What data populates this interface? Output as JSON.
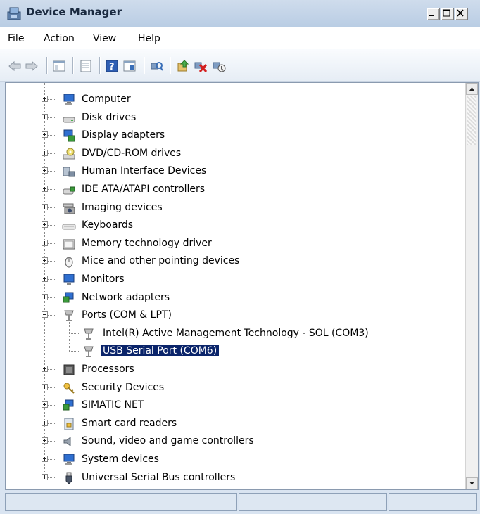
{
  "window": {
    "title": "Device Manager",
    "icon": "device-manager-icon",
    "controls": [
      "minimize",
      "maximize",
      "close"
    ]
  },
  "menu": [
    "File",
    "Action",
    "View",
    "Help"
  ],
  "toolbar": {
    "buttons": [
      "back-arrow-icon",
      "forward-arrow-icon",
      "show-hide-console-tree-icon",
      "properties-icon",
      "help-icon",
      "show-action-pane-icon",
      "scan-hardware-icon",
      "update-driver-icon",
      "uninstall-device-icon",
      "disable-device-icon"
    ]
  },
  "tree": {
    "items": [
      {
        "label": "Computer",
        "icon": "computer-icon",
        "expanded": false
      },
      {
        "label": "Disk drives",
        "icon": "disk-drive-icon",
        "expanded": false
      },
      {
        "label": "Display adapters",
        "icon": "display-adapter-icon",
        "expanded": false
      },
      {
        "label": "DVD/CD-ROM drives",
        "icon": "dvd-drive-icon",
        "expanded": false
      },
      {
        "label": "Human Interface Devices",
        "icon": "hid-icon",
        "expanded": false
      },
      {
        "label": "IDE ATA/ATAPI controllers",
        "icon": "ide-controller-icon",
        "expanded": false
      },
      {
        "label": "Imaging devices",
        "icon": "camera-icon",
        "expanded": false
      },
      {
        "label": "Keyboards",
        "icon": "keyboard-icon",
        "expanded": false
      },
      {
        "label": "Memory technology driver",
        "icon": "memory-icon",
        "expanded": false
      },
      {
        "label": "Mice and other pointing devices",
        "icon": "mouse-icon",
        "expanded": false
      },
      {
        "label": "Monitors",
        "icon": "monitor-icon",
        "expanded": false
      },
      {
        "label": "Network adapters",
        "icon": "network-icon",
        "expanded": false
      },
      {
        "label": "Ports (COM & LPT)",
        "icon": "port-icon",
        "expanded": true,
        "children": [
          {
            "label": "Intel(R) Active Management Technology - SOL (COM3)",
            "icon": "port-icon",
            "selected": false
          },
          {
            "label": "USB Serial Port (COM6)",
            "icon": "port-icon",
            "selected": true
          }
        ]
      },
      {
        "label": "Processors",
        "icon": "processor-icon",
        "expanded": false
      },
      {
        "label": "Security Devices",
        "icon": "key-icon",
        "expanded": false
      },
      {
        "label": "SIMATIC NET",
        "icon": "network-icon",
        "expanded": false
      },
      {
        "label": "Smart card readers",
        "icon": "smartcard-icon",
        "expanded": false
      },
      {
        "label": "Sound, video and game controllers",
        "icon": "speaker-icon",
        "expanded": false
      },
      {
        "label": "System devices",
        "icon": "computer-icon",
        "expanded": false
      },
      {
        "label": "Universal Serial Bus controllers",
        "icon": "usb-icon",
        "expanded": false
      }
    ]
  },
  "status": {
    "panes": [
      "",
      "",
      ""
    ]
  }
}
